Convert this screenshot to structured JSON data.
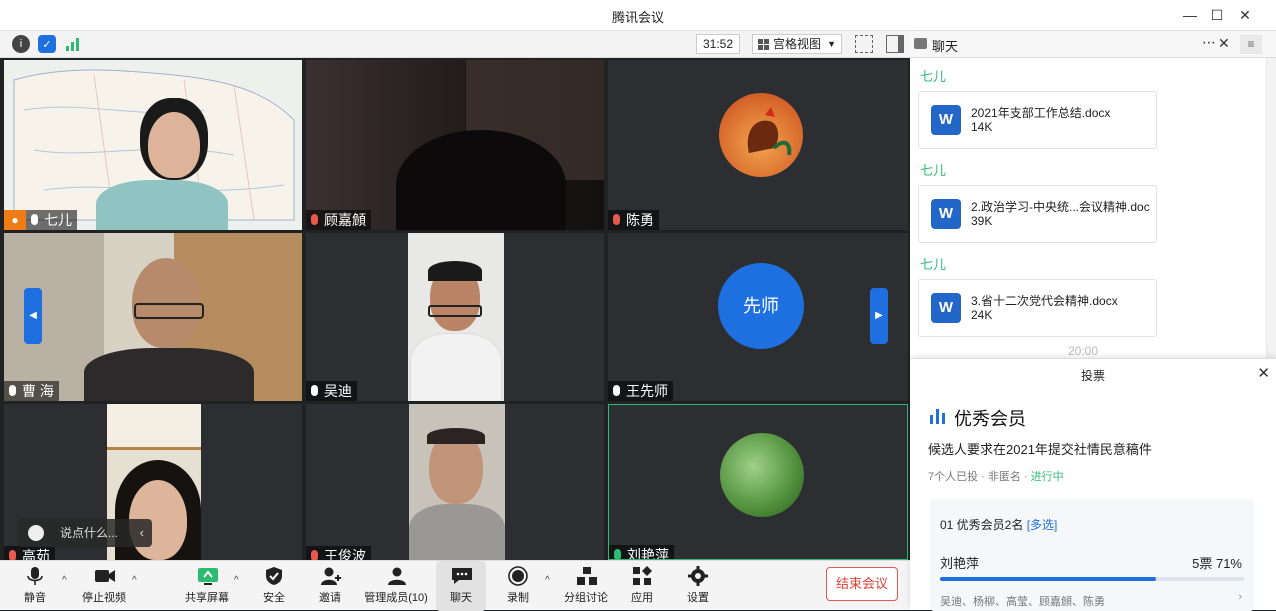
{
  "window": {
    "title": "腾讯会议"
  },
  "topbar": {
    "timer": "31:52",
    "view_label": "宫格视图"
  },
  "chat": {
    "title": "聊天",
    "messages": [
      {
        "sender": "七儿",
        "file_name": "2021年支部工作总结.docx",
        "file_size": "14K"
      },
      {
        "sender": "七儿",
        "file_name": "2.政治学习-中央统...会议精神.doc",
        "file_size": "39K"
      },
      {
        "sender": "七儿",
        "file_name": "3.省十二次党代会精神.docx",
        "file_size": "24K"
      }
    ],
    "timestamp": "20:00",
    "file_icon_letter": "W"
  },
  "participants": [
    {
      "name": "七儿",
      "mic": "on",
      "host": true
    },
    {
      "name": "顾嘉頠",
      "mic": "off"
    },
    {
      "name": "陈勇",
      "mic": "off"
    },
    {
      "name": "曹 海",
      "mic": "on"
    },
    {
      "name": "吴迪",
      "mic": "on"
    },
    {
      "name": "王先师",
      "mic": "on",
      "avatar_text": "先师"
    },
    {
      "name": "高茹",
      "mic": "off"
    },
    {
      "name": "王俊波",
      "mic": "off"
    },
    {
      "name": "刘艳萍",
      "mic": "on"
    }
  ],
  "chat_input": {
    "placeholder": "说点什么..."
  },
  "toolbar": {
    "mute": "静音",
    "stop_video": "停止视频",
    "share": "共享屏幕",
    "security": "安全",
    "invite": "邀请",
    "members": "管理成员(10)",
    "chat": "聊天",
    "record": "录制",
    "breakout": "分组讨论",
    "apps": "应用",
    "settings": "设置",
    "end": "结束会议"
  },
  "vote": {
    "header": "投票",
    "title": "优秀会员",
    "subtitle": "候选人要求在2021年提交社情民意稿件",
    "meta": "7个人已投 · 非匿名 · ",
    "status": "进行中",
    "option_header": "01  优秀会员2名 ",
    "option_multi": "[多选]",
    "candidate": "刘艳萍",
    "votes": "5票 71%",
    "percent": 71,
    "voters": "吴迪、杨柳、高莹、顾嘉頠、陈勇"
  },
  "colors": {
    "accent": "#1e6fe0",
    "green": "#2dbb74",
    "end_red": "#e04236"
  }
}
